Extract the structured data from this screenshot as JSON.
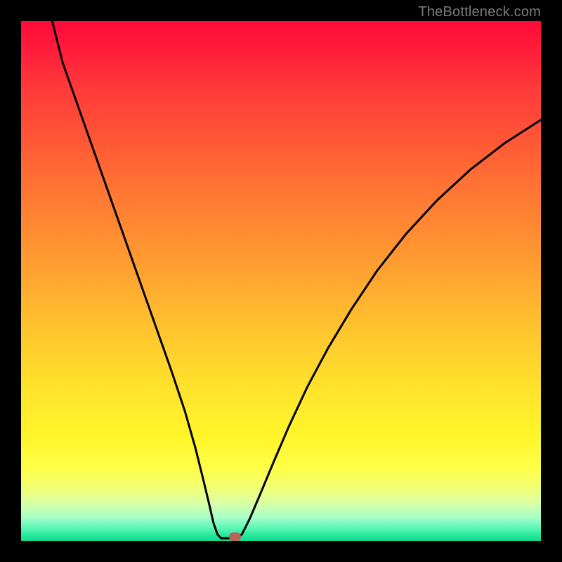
{
  "watermark": "TheBottleneck.com",
  "chart_data": {
    "type": "line",
    "title": "",
    "xlabel": "",
    "ylabel": "",
    "xlim": [
      0,
      100
    ],
    "ylim": [
      0,
      100
    ],
    "grid": false,
    "legend": false,
    "curve_points": [
      {
        "x": 6.0,
        "y": 100.0
      },
      {
        "x": 8.0,
        "y": 92.0
      },
      {
        "x": 11.0,
        "y": 83.5
      },
      {
        "x": 14.0,
        "y": 75.0
      },
      {
        "x": 17.0,
        "y": 66.5
      },
      {
        "x": 20.0,
        "y": 58.0
      },
      {
        "x": 23.0,
        "y": 49.5
      },
      {
        "x": 26.0,
        "y": 41.0
      },
      {
        "x": 29.0,
        "y": 32.5
      },
      {
        "x": 31.5,
        "y": 25.0
      },
      {
        "x": 33.5,
        "y": 18.0
      },
      {
        "x": 35.0,
        "y": 12.0
      },
      {
        "x": 36.2,
        "y": 7.0
      },
      {
        "x": 37.0,
        "y": 3.5
      },
      {
        "x": 37.8,
        "y": 1.2
      },
      {
        "x": 38.5,
        "y": 0.5
      },
      {
        "x": 40.0,
        "y": 0.5
      },
      {
        "x": 41.5,
        "y": 0.5
      },
      {
        "x": 42.5,
        "y": 1.3
      },
      {
        "x": 44.0,
        "y": 4.3
      },
      {
        "x": 46.0,
        "y": 9.0
      },
      {
        "x": 48.5,
        "y": 15.0
      },
      {
        "x": 51.5,
        "y": 22.0
      },
      {
        "x": 55.0,
        "y": 29.5
      },
      {
        "x": 59.0,
        "y": 37.0
      },
      {
        "x": 63.5,
        "y": 44.5
      },
      {
        "x": 68.5,
        "y": 52.0
      },
      {
        "x": 74.0,
        "y": 59.0
      },
      {
        "x": 80.0,
        "y": 65.5
      },
      {
        "x": 86.5,
        "y": 71.5
      },
      {
        "x": 93.0,
        "y": 76.5
      },
      {
        "x": 100.0,
        "y": 81.0
      }
    ],
    "marker": {
      "x": 41.2,
      "y": 0.4,
      "color": "#c06058"
    },
    "gradient_stops": [
      {
        "pos": 0,
        "color": "#ff0a3a"
      },
      {
        "pos": 50,
        "color": "#ffa730"
      },
      {
        "pos": 80,
        "color": "#fff62a"
      },
      {
        "pos": 100,
        "color": "#12d98e"
      }
    ],
    "line_color": "#000000",
    "line_width": 3
  }
}
